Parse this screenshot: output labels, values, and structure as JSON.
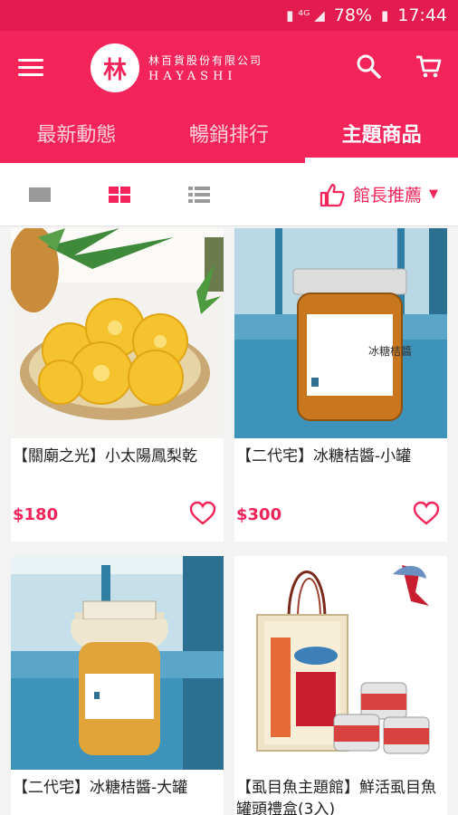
{
  "status": {
    "battery": "78%",
    "time": "17:44",
    "network": "4G"
  },
  "brand": {
    "logo_char": "林",
    "name_cn": "林百貨股份有限公司",
    "name_en": "HAYASHI"
  },
  "tabs": [
    {
      "label": "最新動態"
    },
    {
      "label": "暢銷排行"
    },
    {
      "label": "主題商品"
    }
  ],
  "toolbar": {
    "sort_label": "館長推薦"
  },
  "products": [
    {
      "name": "【關廟之光】小太陽鳳梨乾",
      "price": "$180"
    },
    {
      "name": "【二代宅】冰糖桔醬-小罐",
      "price": "$300"
    },
    {
      "name": "【二代宅】冰糖桔醬-大罐",
      "price": ""
    },
    {
      "name": "【虱目魚主題館】鮮活虱目魚罐頭禮盒(3入)",
      "price": ""
    }
  ],
  "colors": {
    "accent": "#f2245a"
  }
}
